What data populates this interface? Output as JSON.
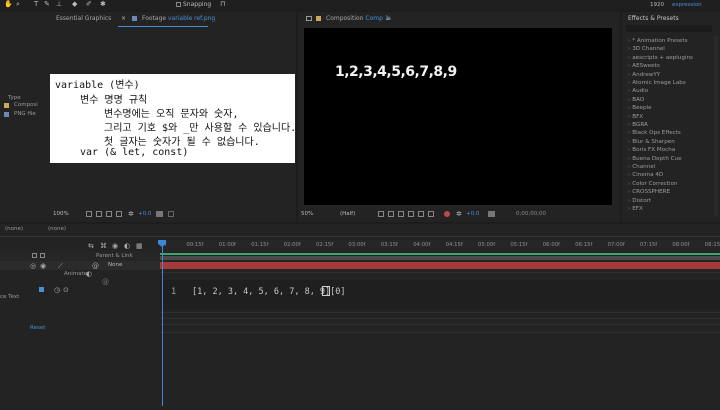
{
  "toolbar": {
    "snapping_label": "Snapping",
    "right_num": "1920",
    "right_label": "expression"
  },
  "project": {
    "type_label": "Type",
    "items": [
      "Composi",
      "PNG file"
    ]
  },
  "tabs": {
    "essential_graphics": "Essential Graphics",
    "footage_prefix": "Footage",
    "footage_name": "variable ref.png",
    "composition_prefix": "Composition",
    "composition_name": "Comp 1",
    "effects": "Effects & Presets"
  },
  "code_card": {
    "lines": [
      "variable (변수)",
      "변수 명명 규칙",
      "변수명에는 오직 문자와 숫자,",
      "그리고 기호 $와 _만 사용할 수 있습니다.",
      "첫 글자는 숫자가 될 수 없습니다.",
      "var (& let, const)"
    ]
  },
  "composition": {
    "text": "1,2,3,4,5,6,7,8,9"
  },
  "viewer_footage_bar": {
    "zoom": "100%",
    "value": "+0.0"
  },
  "viewer_comp_bar": {
    "zoom": "50%",
    "resolution": "(Half)",
    "value": "+0.0",
    "timecode": "0;00;00;00"
  },
  "effects": {
    "search_placeholder": "",
    "items": [
      "* Animation Presets",
      "3D Channel",
      "aescripts + aeplugins",
      "AESweets",
      "AndrewYY",
      "Atomic Image Labs",
      "Audio",
      "BAO",
      "Beeple",
      "BFX",
      "BGRA",
      "Black Ops Effects",
      "Blur & Sharpen",
      "Boris FX Mocha",
      "Buena Depth Cue",
      "Channel",
      "Cinema 4D",
      "Color Correction",
      "CROSSPHERE",
      "Distort",
      "EFX"
    ]
  },
  "timeline": {
    "none_left": "(none)",
    "none_right": "(none)",
    "parent_label": "Parent & Link",
    "parent_value": "None",
    "animate_label": "Animate",
    "source_text_label": "ce Text",
    "reset_label": "Reset",
    "ruler_labels": [
      "0f",
      "00:15f",
      "01:00f",
      "01:15f",
      "02:00f",
      "02:15f",
      "03:00f",
      "03:15f",
      "04:00f",
      "04:15f",
      "05:00f",
      "05:15f",
      "06:00f",
      "06:15f",
      "07:00f",
      "07:15f",
      "08:00f",
      "08:15f"
    ],
    "expression_line_number": "1",
    "expression": "[1, 2, 3, 4, 5, 6, 7, 8, 9][0]"
  },
  "colors": {
    "accent_blue": "#4a8fd6",
    "layer_red": "#a63a3a",
    "work_area_green": "#3aa86a"
  }
}
